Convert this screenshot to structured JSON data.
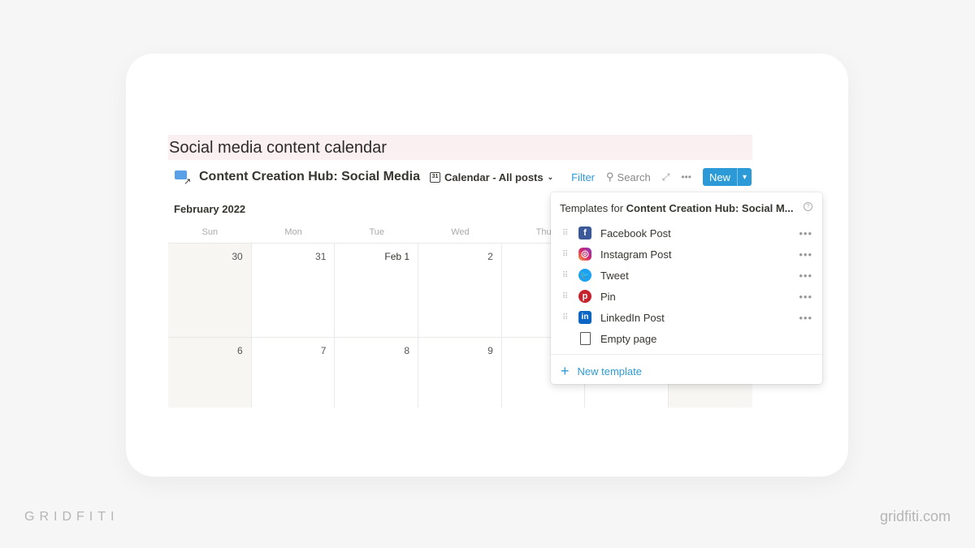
{
  "page_title": "Social media content calendar",
  "toolbar": {
    "db_name": "Content Creation Hub: Social Media",
    "view": "Calendar - All posts",
    "filter": "Filter",
    "search": "Search",
    "new": "New"
  },
  "calendar": {
    "month": "February 2022",
    "weekdays": [
      "Sun",
      "Mon",
      "Tue",
      "Wed",
      "Thu"
    ],
    "rows": [
      [
        "30",
        "31",
        "Feb 1",
        "2"
      ],
      [
        "6",
        "7",
        "8",
        "9"
      ]
    ]
  },
  "templates": {
    "header_prefix": "Templates for ",
    "header_db": "Content Creation Hub: Social M...",
    "items": [
      {
        "label": "Facebook Post",
        "icon": "facebook-icon",
        "color": "#3b5998"
      },
      {
        "label": "Instagram Post",
        "icon": "instagram-icon",
        "color": "#d6246e"
      },
      {
        "label": "Tweet",
        "icon": "twitter-icon",
        "color": "#1da1f2"
      },
      {
        "label": "Pin",
        "icon": "pinterest-icon",
        "color": "#c8232c"
      },
      {
        "label": "LinkedIn Post",
        "icon": "linkedin-icon",
        "color": "#0a66c2"
      }
    ],
    "empty": "Empty page",
    "new_template": "New template"
  },
  "footer": {
    "brand": "GRIDFITI",
    "url": "gridfiti.com"
  },
  "colors": {
    "accent": "#2c9ad6",
    "title_bg": "#fbf0f1"
  }
}
